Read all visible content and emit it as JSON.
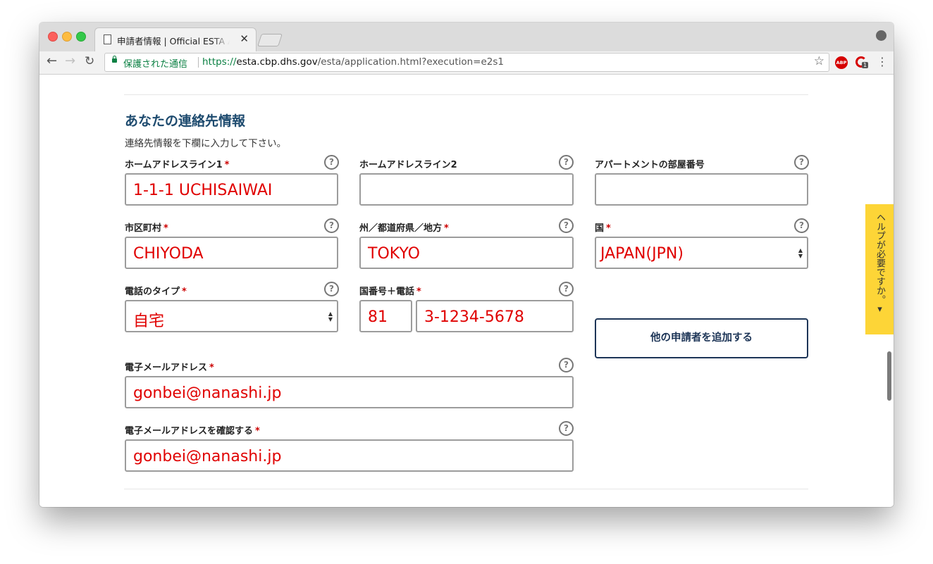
{
  "browser": {
    "tab_title": "申請者情報 | Official ESTA Application",
    "tab_close": "✕",
    "secure_label": "保護された通信",
    "url_scheme": "https://",
    "url_host": "esta.cbp.dhs.gov",
    "url_path": "/esta/application.html?execution=e2s1",
    "abp_label": "ABP",
    "ext_badge": "1",
    "back": "←",
    "forward": "→",
    "reload": "↻",
    "star": "☆",
    "menu": "⋮"
  },
  "form": {
    "section_title": "あなたの連絡先情報",
    "instruction": "連絡先情報を下欄に入力して下さい。",
    "help_glyph": "?",
    "required_mark": "*",
    "fields": {
      "address1": {
        "label": "ホームアドレスライン1",
        "value": "1-1-1 UCHISAIWAI"
      },
      "address2": {
        "label": "ホームアドレスライン2",
        "value": ""
      },
      "apartment": {
        "label": "アパートメントの部屋番号",
        "value": ""
      },
      "city": {
        "label": "市区町村",
        "value": "CHIYODA"
      },
      "state": {
        "label": "州／都道府県／地方",
        "value": "TOKYO"
      },
      "country": {
        "label": "国",
        "value": "JAPAN(JPN)"
      },
      "phone_type": {
        "label": "電話のタイプ",
        "value": "自宅"
      },
      "phone": {
        "label": "国番号＋電話",
        "country_code": "81",
        "number": "3-1234-5678"
      },
      "email": {
        "label": "電子メールアドレス",
        "value": "gonbei@nanashi.jp"
      },
      "email_confirm": {
        "label": "電子メールアドレスを確認する",
        "value": "gonbei@nanashi.jp"
      }
    },
    "add_applicant_button": "他の申請者を追加する"
  },
  "help_tab": {
    "label": "ヘルプが必要ですか。▾"
  },
  "colors": {
    "required": "#cc0000",
    "input_text": "#e00000",
    "heading": "#1d4a6e",
    "help_tab": "#fdd537",
    "button_border": "#1d3557"
  }
}
